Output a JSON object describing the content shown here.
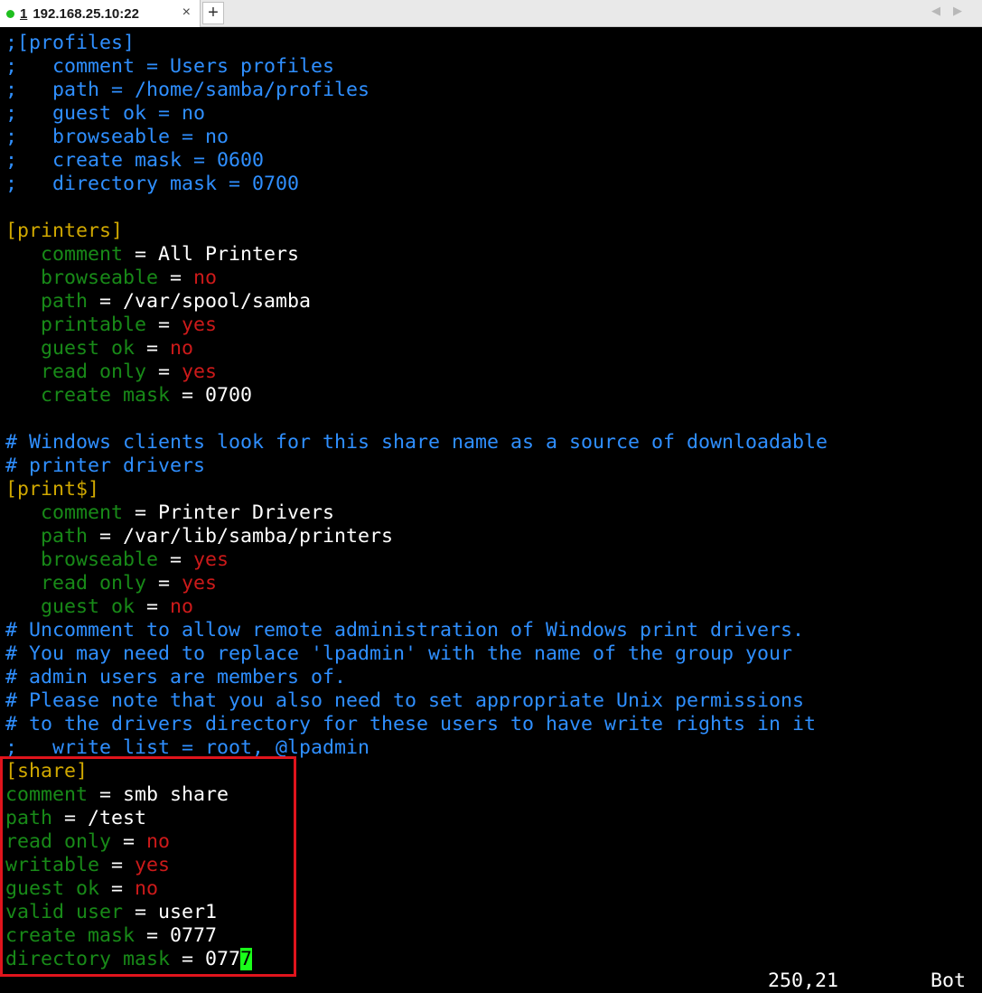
{
  "tabbar": {
    "tab_number": "1",
    "tab_title": "192.168.25.10:22",
    "close_glyph": "×",
    "new_tab_glyph": "+",
    "nav_left": "◀",
    "nav_right": "▶"
  },
  "terminal": {
    "lines": [
      [
        {
          "t": ";[profiles]",
          "c": "comment"
        }
      ],
      [
        {
          "t": ";   comment = Users profiles",
          "c": "comment"
        }
      ],
      [
        {
          "t": ";   path = /home/samba/profiles",
          "c": "comment"
        }
      ],
      [
        {
          "t": ";   guest ok = no",
          "c": "comment"
        }
      ],
      [
        {
          "t": ";   browseable = no",
          "c": "comment"
        }
      ],
      [
        {
          "t": ";   create mask = 0600",
          "c": "comment"
        }
      ],
      [
        {
          "t": ";   directory mask = 0700",
          "c": "comment"
        }
      ],
      [],
      [
        {
          "t": "[printers]",
          "c": "section"
        }
      ],
      [
        {
          "t": "   "
        },
        {
          "t": "comment",
          "c": "key"
        },
        {
          "t": " = All Printers",
          "c": "val"
        }
      ],
      [
        {
          "t": "   "
        },
        {
          "t": "browseable",
          "c": "key"
        },
        {
          "t": " = ",
          "c": "val"
        },
        {
          "t": "no",
          "c": "bool"
        }
      ],
      [
        {
          "t": "   "
        },
        {
          "t": "path",
          "c": "key"
        },
        {
          "t": " = /var/spool/samba",
          "c": "val"
        }
      ],
      [
        {
          "t": "   "
        },
        {
          "t": "printable",
          "c": "key"
        },
        {
          "t": " = ",
          "c": "val"
        },
        {
          "t": "yes",
          "c": "bool"
        }
      ],
      [
        {
          "t": "   "
        },
        {
          "t": "guest ok",
          "c": "key"
        },
        {
          "t": " = ",
          "c": "val"
        },
        {
          "t": "no",
          "c": "bool"
        }
      ],
      [
        {
          "t": "   "
        },
        {
          "t": "read only",
          "c": "key"
        },
        {
          "t": " = ",
          "c": "val"
        },
        {
          "t": "yes",
          "c": "bool"
        }
      ],
      [
        {
          "t": "   "
        },
        {
          "t": "create mask",
          "c": "key"
        },
        {
          "t": " = 0700",
          "c": "val"
        }
      ],
      [],
      [
        {
          "t": "# Windows clients look for this share name as a source of downloadable",
          "c": "comment"
        }
      ],
      [
        {
          "t": "# printer drivers",
          "c": "comment"
        }
      ],
      [
        {
          "t": "[print$]",
          "c": "section"
        }
      ],
      [
        {
          "t": "   "
        },
        {
          "t": "comment",
          "c": "key"
        },
        {
          "t": " = Printer Drivers",
          "c": "val"
        }
      ],
      [
        {
          "t": "   "
        },
        {
          "t": "path",
          "c": "key"
        },
        {
          "t": " = /var/lib/samba/printers",
          "c": "val"
        }
      ],
      [
        {
          "t": "   "
        },
        {
          "t": "browseable",
          "c": "key"
        },
        {
          "t": " = ",
          "c": "val"
        },
        {
          "t": "yes",
          "c": "bool"
        }
      ],
      [
        {
          "t": "   "
        },
        {
          "t": "read only",
          "c": "key"
        },
        {
          "t": " = ",
          "c": "val"
        },
        {
          "t": "yes",
          "c": "bool"
        }
      ],
      [
        {
          "t": "   "
        },
        {
          "t": "guest ok",
          "c": "key"
        },
        {
          "t": " = ",
          "c": "val"
        },
        {
          "t": "no",
          "c": "bool"
        }
      ],
      [
        {
          "t": "# Uncomment to allow remote administration of Windows print drivers.",
          "c": "comment"
        }
      ],
      [
        {
          "t": "# You may need to replace 'lpadmin' with the name of the group your",
          "c": "comment"
        }
      ],
      [
        {
          "t": "# admin users are members of.",
          "c": "comment"
        }
      ],
      [
        {
          "t": "# Please note that you also need to set appropriate Unix permissions",
          "c": "comment"
        }
      ],
      [
        {
          "t": "# to the drivers directory for these users to have write rights in it",
          "c": "comment"
        }
      ],
      [
        {
          "t": ";   write list = root, @lpadmin",
          "c": "comment"
        }
      ],
      [
        {
          "t": "[share]",
          "c": "section"
        }
      ],
      [
        {
          "t": "comment",
          "c": "key"
        },
        {
          "t": " = smb share",
          "c": "val"
        }
      ],
      [
        {
          "t": "path",
          "c": "key"
        },
        {
          "t": " = /test",
          "c": "val"
        }
      ],
      [
        {
          "t": "read only",
          "c": "key"
        },
        {
          "t": " = ",
          "c": "val"
        },
        {
          "t": "no",
          "c": "bool"
        }
      ],
      [
        {
          "t": "writable",
          "c": "key"
        },
        {
          "t": " = ",
          "c": "val"
        },
        {
          "t": "yes",
          "c": "bool"
        }
      ],
      [
        {
          "t": "guest ok",
          "c": "key"
        },
        {
          "t": " = ",
          "c": "val"
        },
        {
          "t": "no",
          "c": "bool"
        }
      ],
      [
        {
          "t": "valid user",
          "c": "key"
        },
        {
          "t": " = user1",
          "c": "val"
        }
      ],
      [
        {
          "t": "create mask",
          "c": "key"
        },
        {
          "t": " = 0777",
          "c": "val"
        }
      ],
      [
        {
          "t": "directory mask",
          "c": "key"
        },
        {
          "t": " = 077",
          "c": "val"
        },
        {
          "t": "7",
          "c": "cursor"
        }
      ]
    ]
  },
  "statusline": {
    "position": "250,21",
    "scroll": "Bot"
  },
  "colors": {
    "comment": "#2f8fff",
    "section": "#d0a800",
    "key": "#188a18",
    "value": "#ffffff",
    "boolean": "#cc1a1a",
    "cursor": "#1aff1a",
    "highlight_border": "#e0141c"
  }
}
